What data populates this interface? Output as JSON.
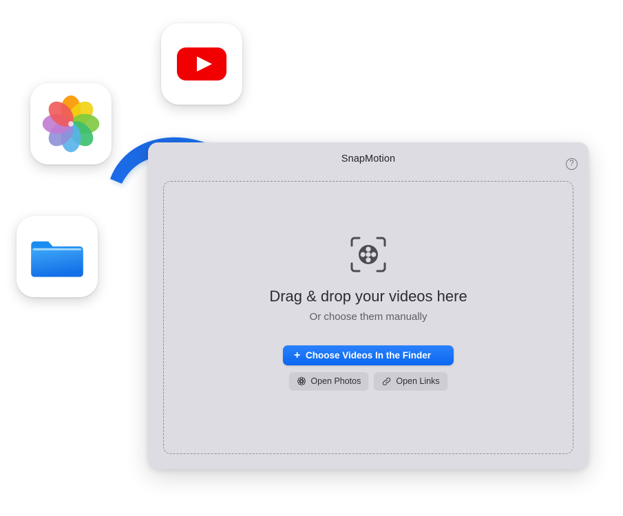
{
  "window": {
    "title": "SnapMotion",
    "help_icon": "question-mark-circle-icon",
    "background_color": "#dedce3"
  },
  "dropzone": {
    "icon": "film-reel-viewfinder-icon",
    "headline": "Drag & drop your videos here",
    "subline": "Or choose them manually",
    "border_style": "dashed",
    "border_color": "#8d8d95"
  },
  "actions": {
    "primary": {
      "label": "Choose Videos In the Finder",
      "icon": "plus-icon",
      "plus_glyph": "+",
      "color": "#0a67ef"
    },
    "secondary": [
      {
        "label": "Open Photos",
        "icon": "photos-flower-icon"
      },
      {
        "label": "Open Links",
        "icon": "link-chain-icon"
      }
    ]
  },
  "source_icons": [
    {
      "name": "youtube-app-icon",
      "label": "YouTube",
      "color": "#ff0000"
    },
    {
      "name": "photos-app-icon",
      "label": "Photos",
      "color": "#ffffff"
    },
    {
      "name": "finder-folder-icon",
      "label": "Folder",
      "color": "#1f8cf5"
    }
  ],
  "arrow": {
    "name": "curved-drag-arrow",
    "color_start": "#1e6ce6",
    "color_end": "#21a7f7",
    "direction": "down-right"
  }
}
